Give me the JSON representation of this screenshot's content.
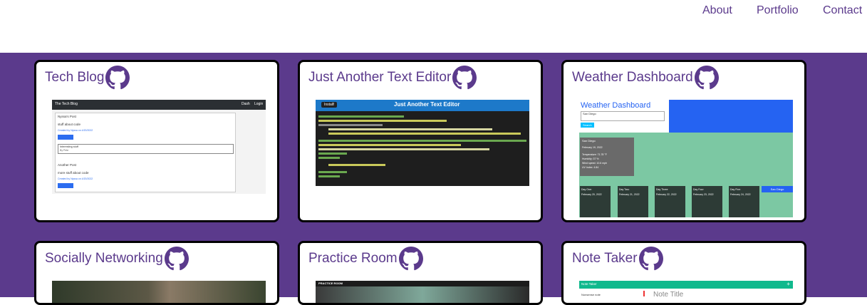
{
  "nav": {
    "about": "About",
    "portfolio": "Portfolio",
    "contact": "Contact"
  },
  "colors": {
    "accent": "#5b3a8c",
    "card_border": "#000000",
    "card_bg": "#ffffff"
  },
  "projects": [
    {
      "title": "Tech Blog",
      "icon": "github-icon"
    },
    {
      "title": "Just Another Text Editor",
      "icon": "github-icon"
    },
    {
      "title": "Weather Dashboard",
      "icon": "github-icon"
    },
    {
      "title": "Socially Networking",
      "icon": "github-icon"
    },
    {
      "title": "Practice Room",
      "icon": "github-icon"
    },
    {
      "title": "Note Taker",
      "icon": "github-icon"
    }
  ],
  "thumbnails": {
    "tech_blog": {
      "brand": "The Tech Blog",
      "nav_dash": "Dash",
      "nav_login": "Login",
      "post1_title": "Nyssa's Post",
      "post1_body": "stuff about code",
      "post1_meta": "Created by Nyssa on 4/20/2022",
      "comment_btn": "Comment",
      "comment_text": "Interesting stuff",
      "comment_by": "By Pete",
      "post2_title": "Another Post",
      "post2_body": "more stuff about code",
      "post2_meta": "Created by Nyssa on 4/20/2022"
    },
    "text_editor": {
      "install": "Install!",
      "title": "Just Another Text Editor"
    },
    "weather": {
      "title": "Weather Dashboard",
      "search_value": "San Diego",
      "search_button": "Search",
      "city": "San Diego",
      "current": [
        "February 19, 2022",
        "Temperature: 71.78 °F",
        "Humidity: 37 %",
        "Wind speed: 10.6 mph",
        "UV Index: 4.84"
      ],
      "saved_city": "San Diego",
      "forecast": [
        {
          "label": "Day One:",
          "date": "February 20, 2022"
        },
        {
          "label": "Day Two:",
          "date": "February 21, 2022"
        },
        {
          "label": "Day Three:",
          "date": "February 22, 2022"
        },
        {
          "label": "Day Four:",
          "date": "February 23, 2022"
        },
        {
          "label": "Day Five:",
          "date": "February 24, 2022"
        }
      ]
    },
    "practice_room": {
      "title": "PRACTICE ROOM"
    },
    "note_taker": {
      "header": "Note Taker",
      "note_title_placeholder": "Note Title",
      "list_item": "Nonsense note"
    }
  }
}
